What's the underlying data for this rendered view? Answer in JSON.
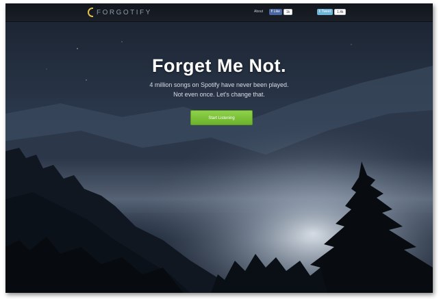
{
  "header": {
    "logo_text": "FORGOTIFY",
    "nav_about": "About",
    "facebook": {
      "label": "Like",
      "count": "1k"
    },
    "twitter": {
      "label": "Tweet",
      "count": "1.4k"
    }
  },
  "hero": {
    "title": "Forget Me Not.",
    "subtitle_line1": "4 million songs on Spotify have never been played.",
    "subtitle_line2": "Not even once. Let's change that.",
    "cta_label": "Start Listening"
  },
  "colors": {
    "accent_green": "#7cc23a",
    "logo_gold": "#e2c24a",
    "facebook_blue": "#4a66a0",
    "twitter_blue": "#6fb5d8"
  },
  "icons": {
    "logo": "crescent-moon-icon",
    "facebook": "facebook-icon",
    "twitter": "twitter-icon"
  }
}
